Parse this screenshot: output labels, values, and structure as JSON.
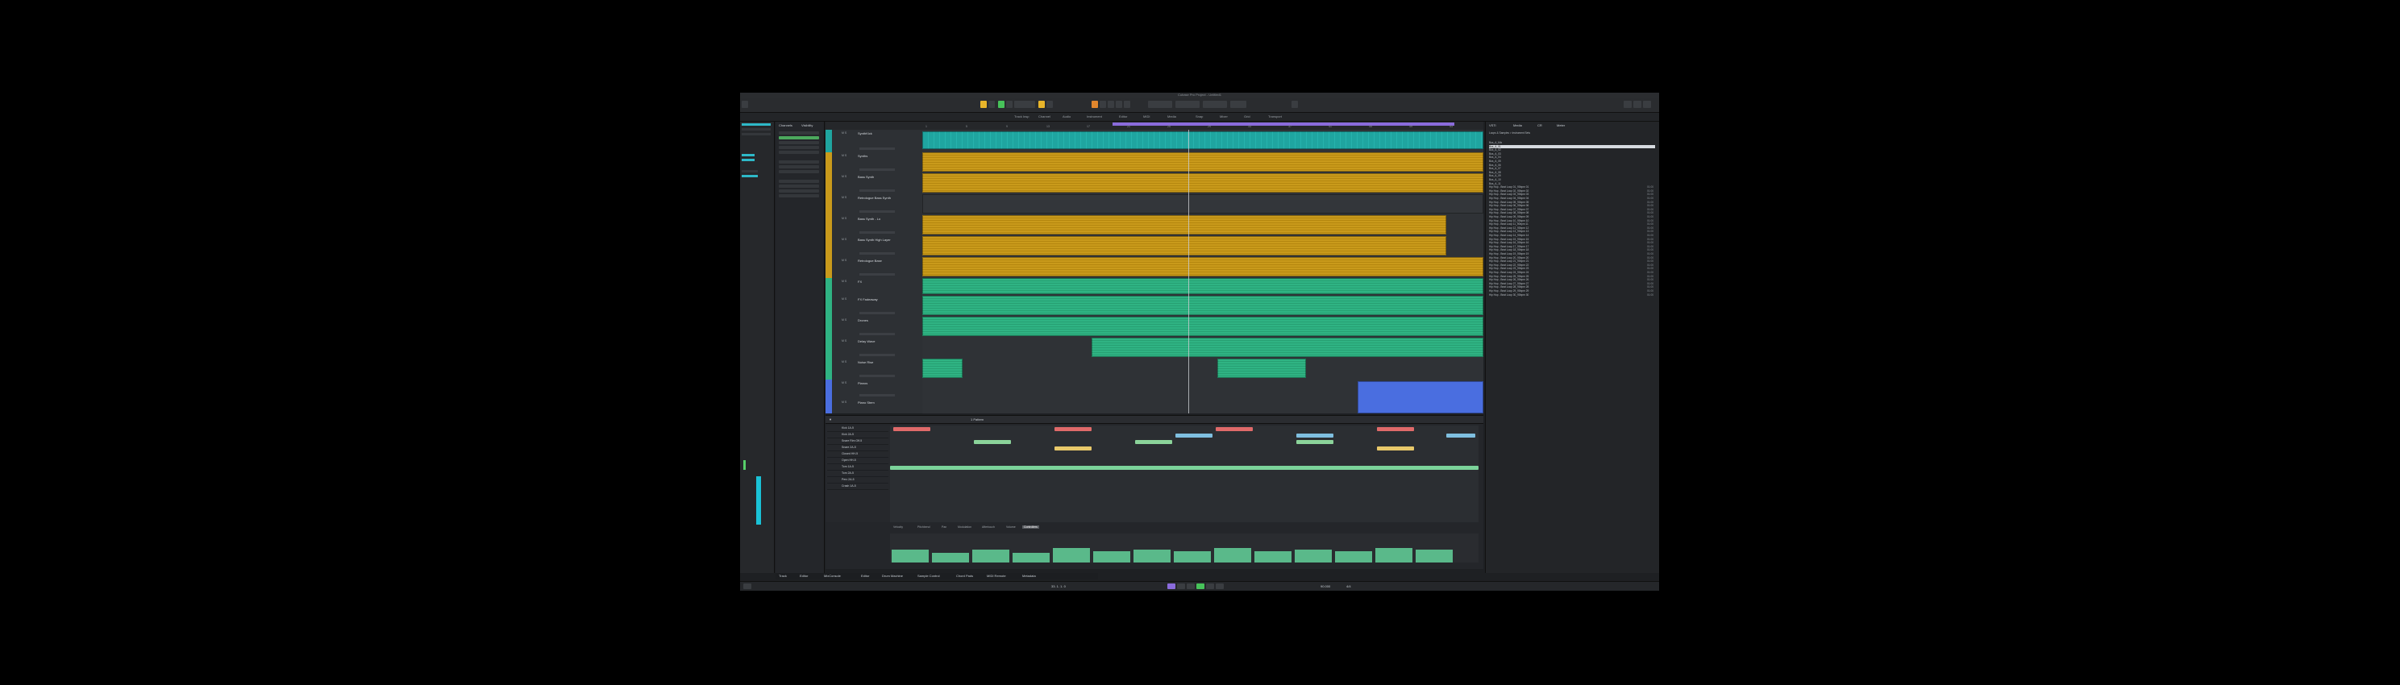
{
  "window": {
    "title": "Cubase Pro Project - Untitled1"
  },
  "toolbar": {
    "accent_color": "#e8b52a"
  },
  "quick_zones": [
    "Track Insp",
    "Channel",
    "Audio",
    "Instrument",
    "Editor",
    "MIDI",
    "Media",
    "Snap",
    "Mixer",
    "Grid",
    "Transport"
  ],
  "tracklist_panel": {
    "tab_a": "Channels",
    "tab_b": "Visibility"
  },
  "ruler": {
    "ticks": [
      "1",
      "5",
      "9",
      "13",
      "17",
      "21",
      "25",
      "29",
      "33",
      "37",
      "41",
      "45",
      "49",
      "53"
    ]
  },
  "tracks": [
    {
      "name": "SynthKick",
      "color": "#1fa5a0"
    },
    {
      "name": "Synths",
      "color": "#c99a1b"
    },
    {
      "name": "Bass Synth",
      "color": "#c99a1b"
    },
    {
      "name": "Retrologue Bass Synth",
      "color": "#c99a1b"
    },
    {
      "name": "Bass Synth - Lo",
      "color": "#c99a1b"
    },
    {
      "name": "Bass Synth High Layer",
      "color": "#c99a1b"
    },
    {
      "name": "Retrologue Base",
      "color": "#c99a1b"
    },
    {
      "name": "FX",
      "color": "#2fb383"
    },
    {
      "name": "FX Fadeaway",
      "color": "#2fb383"
    },
    {
      "name": "Drones",
      "color": "#2fb383"
    },
    {
      "name": "Delay Wave",
      "color": "#2fb383"
    },
    {
      "name": "Noise Rise",
      "color": "#2fb383"
    },
    {
      "name": "Pianos",
      "color": "#4a6ee0"
    },
    {
      "name": "Piano Stem",
      "color": "#4a6ee0"
    }
  ],
  "drum_editor": {
    "pattern": "1 Pattern",
    "drums": [
      "Kick 1A-5",
      "Kick 2A-5",
      "Snare Rim Off-5",
      "Snare 2A-5",
      "Closed HH-5",
      "Open HH-5",
      "Tom 1A-5",
      "Tom 2A-5",
      "Perc 2A-5",
      "Crash 1A-5"
    ],
    "velocity_tabs": [
      "Velocity",
      "Pitchbend",
      "Pan",
      "Modulation",
      "Aftertouch",
      "Volume",
      "Controllers"
    ],
    "lane_label": "Parameter Lane"
  },
  "browser": {
    "tabs": [
      "VSTi",
      "Media",
      "CR",
      "Meter"
    ],
    "path": "Loops & Samples > Instrument Sets",
    "files": [
      {
        "name": "Bus_A_Mix",
        "len": ""
      },
      {
        "name": "Bus_A_01",
        "len": ""
      },
      {
        "name": "Bus_A_02",
        "len": ""
      },
      {
        "name": "Bus_A_03",
        "len": ""
      },
      {
        "name": "Bus_A_04",
        "len": ""
      },
      {
        "name": "Bus_A_05",
        "len": ""
      },
      {
        "name": "Bus_A_06",
        "len": ""
      },
      {
        "name": "Bus_A_07",
        "len": ""
      },
      {
        "name": "Bus_A_08",
        "len": ""
      },
      {
        "name": "Bus_A_09",
        "len": ""
      },
      {
        "name": "Bus_A_10",
        "len": ""
      },
      {
        "name": "Bus_A_11",
        "len": ""
      },
      {
        "name": "Hip Hop - Beat Loop 01_90bpm 01",
        "len": "01:00"
      },
      {
        "name": "Hip Hop - Beat Loop 02_90bpm 02",
        "len": "01:00"
      },
      {
        "name": "Hip Hop - Beat Loop 03_90bpm 03",
        "len": "01:00"
      },
      {
        "name": "Hip Hop - Beat Loop 04_90bpm 04",
        "len": "01:00"
      },
      {
        "name": "Hip Hop - Beat Loop 05_90bpm 05",
        "len": "01:00"
      },
      {
        "name": "Hip Hop - Beat Loop 06_90bpm 06",
        "len": "01:00"
      },
      {
        "name": "Hip Hop - Beat Loop 07_90bpm 07",
        "len": "01:00"
      },
      {
        "name": "Hip Hop - Beat Loop 08_90bpm 08",
        "len": "01:00"
      },
      {
        "name": "Hip Hop - Beat Loop 09_90bpm 09",
        "len": "01:00"
      },
      {
        "name": "Hip Hop - Beat Loop 10_90bpm 10",
        "len": "01:00"
      },
      {
        "name": "Hip Hop - Beat Loop 11_90bpm 11",
        "len": "01:00"
      },
      {
        "name": "Hip Hop - Beat Loop 12_90bpm 12",
        "len": "01:00"
      },
      {
        "name": "Hip Hop - Beat Loop 13_90bpm 13",
        "len": "01:00"
      },
      {
        "name": "Hip Hop - Beat Loop 14_90bpm 14",
        "len": "01:00"
      },
      {
        "name": "Hip Hop - Beat Loop 15_90bpm 15",
        "len": "01:00"
      },
      {
        "name": "Hip Hop - Beat Loop 16_90bpm 16",
        "len": "01:00"
      },
      {
        "name": "Hip Hop - Beat Loop 17_90bpm 17",
        "len": "01:00"
      },
      {
        "name": "Hip Hop - Beat Loop 18_90bpm 18",
        "len": "01:00"
      },
      {
        "name": "Hip Hop - Beat Loop 19_90bpm 19",
        "len": "01:00"
      },
      {
        "name": "Hip Hop - Beat Loop 20_90bpm 20",
        "len": "01:00"
      },
      {
        "name": "Hip Hop - Beat Loop 21_90bpm 21",
        "len": "01:00"
      },
      {
        "name": "Hip Hop - Beat Loop 22_90bpm 22",
        "len": "01:00"
      },
      {
        "name": "Hip Hop - Beat Loop 23_90bpm 23",
        "len": "01:00"
      },
      {
        "name": "Hip Hop - Beat Loop 24_90bpm 24",
        "len": "01:00"
      },
      {
        "name": "Hip Hop - Beat Loop 25_90bpm 25",
        "len": "01:00"
      },
      {
        "name": "Hip Hop - Beat Loop 26_90bpm 26",
        "len": "01:00"
      },
      {
        "name": "Hip Hop - Beat Loop 27_90bpm 27",
        "len": "01:00"
      },
      {
        "name": "Hip Hop - Beat Loop 28_90bpm 28",
        "len": "01:00"
      },
      {
        "name": "Hip Hop - Beat Loop 29_90bpm 29",
        "len": "01:00"
      },
      {
        "name": "Hip Hop - Beat Loop 30_90bpm 30",
        "len": "01:00"
      }
    ]
  },
  "bottom_tabs": [
    "Track",
    "Editor",
    "MixConsole",
    "Editor",
    "Drum Machine",
    "Sample Control",
    "Chord Pads",
    "MIDI Remote",
    "Metadata"
  ],
  "transport": {
    "position": "33. 1. 1. 0",
    "tempo": "90.000",
    "signature": "4/4"
  }
}
